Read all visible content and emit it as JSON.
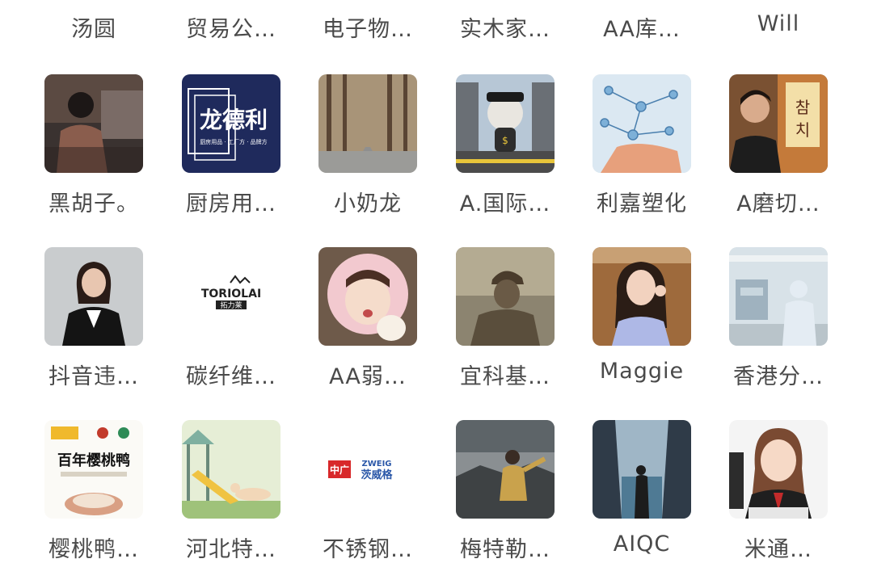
{
  "top_row_names": [
    "汤圆",
    "贸易公…",
    "电子物…",
    "实木家…",
    "AA库…",
    "Will"
  ],
  "rows": [
    {
      "contacts": [
        {
          "name": "黑胡子。",
          "avatar": "person-dark-street"
        },
        {
          "name": "厨房用…",
          "avatar": "brand-logo-longdeli",
          "logo_title": "龙德利",
          "logo_sub": "厨房用品 · 工厂方 · 品牌方"
        },
        {
          "name": "小奶龙",
          "avatar": "tree-lined-road"
        },
        {
          "name": "A.国际…",
          "avatar": "cartoon-cat-street"
        },
        {
          "name": "利嘉塑化",
          "avatar": "molecule-hand"
        },
        {
          "name": "A磨切…",
          "avatar": "man-restaurant",
          "sign_text": "참\n치"
        }
      ]
    },
    {
      "contacts": [
        {
          "name": "抖音违…",
          "avatar": "business-woman"
        },
        {
          "name": "碳纤维…",
          "avatar": "brand-logo-toriolai",
          "logo_title": "TORIOLAI",
          "logo_sub": "拓力莱"
        },
        {
          "name": "AA弱…",
          "avatar": "girl-pink-hood"
        },
        {
          "name": "宜科基…",
          "avatar": "man-cap-sunset"
        },
        {
          "name": "Maggie",
          "avatar": "girl-peace-sign"
        },
        {
          "name": "香港分…",
          "avatar": "factory-worker"
        }
      ]
    },
    {
      "contacts": [
        {
          "name": "樱桃鸭…",
          "avatar": "brand-poster-duck",
          "logo_title": "百年樱桃鸭"
        },
        {
          "name": "河北特…",
          "avatar": "cartoon-playground"
        },
        {
          "name": "不锈钢…",
          "avatar": "brand-logo-zweig",
          "logo_title": "ZWEIG",
          "logo_sub": "茨威格",
          "logo_badge": "中广"
        },
        {
          "name": "梅特勒…",
          "avatar": "man-mountain"
        },
        {
          "name": "AIQC",
          "avatar": "canal-person"
        },
        {
          "name": "米通…",
          "avatar": "cartoon-girl-office"
        }
      ]
    }
  ]
}
